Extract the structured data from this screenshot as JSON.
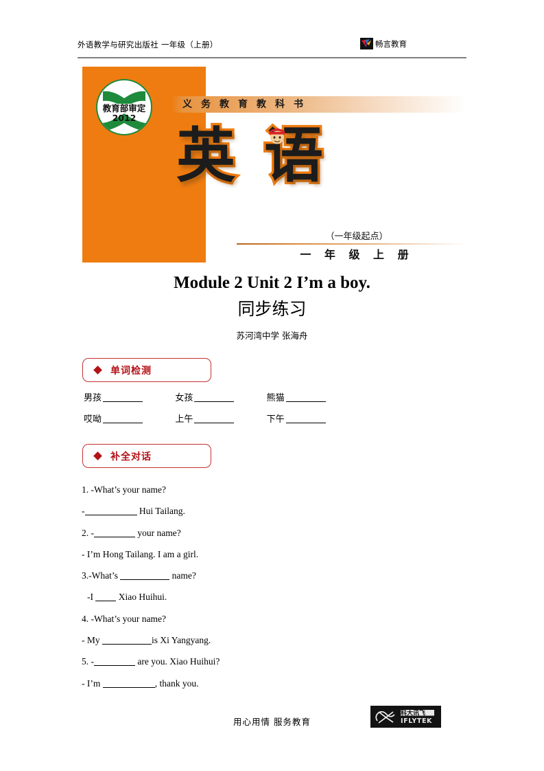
{
  "header": {
    "publisher_line": "外语教学与研究出版社  一年级（上册）",
    "brand_label": "畅言教育",
    "brand_logo_icon": "butterfly-logo-icon"
  },
  "cover": {
    "seal_text": "教育部审定",
    "seal_year": "2012",
    "band_text": "义务教育教科书",
    "subject_char_1": "英",
    "subject_char_2": "语",
    "mascot_icon": "cartoon-face-red-cap-icon",
    "starting_grade_note": "（一年级起点）",
    "grade_volume": "一 年 级 上 册",
    "orange": "#ef7c10",
    "seal_green": "#1e8b3c"
  },
  "document": {
    "title": "Module 2 Unit 2 I’m a boy.",
    "subtitle": "同步练习",
    "author": "苏河湾中学  张海舟"
  },
  "sections": [
    {
      "label": "单词检测",
      "bullet_icon": "red-diamond-icon",
      "accent_color": "#b31217",
      "border_color": "#c3312f"
    },
    {
      "label": "补全对话",
      "bullet_icon": "red-diamond-icon",
      "accent_color": "#b31217",
      "border_color": "#c3312f"
    }
  ],
  "vocabulary": {
    "rows": [
      [
        {
          "prompt": "男孩"
        },
        {
          "prompt": "女孩"
        },
        {
          "prompt": "熊猫"
        }
      ],
      [
        {
          "prompt": "哎呦"
        },
        {
          "prompt": "上午"
        },
        {
          "prompt": "下午"
        }
      ]
    ]
  },
  "dialogue": {
    "lines": [
      {
        "pre": "1. -What’s your name?",
        "blank": "",
        "post": "",
        "indent": false
      },
      {
        "pre": "-",
        "blank": "w10",
        "post": " Hui Tailang.",
        "indent": false
      },
      {
        "pre": "2. -",
        "blank": "w7",
        "post": " your name?",
        "indent": false
      },
      {
        "pre": "- I’m Hong Tailang. I am a girl.",
        "blank": "",
        "post": "",
        "indent": false
      },
      {
        "pre": "3.-What’s ",
        "blank": "w9",
        "post": " name?",
        "indent": false
      },
      {
        "pre": "-I ",
        "blank": "w4",
        "post": " Xiao Huihui.",
        "indent": true
      },
      {
        "pre": "4. -What’s your name?",
        "blank": "",
        "post": "",
        "indent": false
      },
      {
        "pre": "- My ",
        "blank": "w9",
        "post": "is Xi Yangyang.",
        "indent": false
      },
      {
        "pre": "5. -",
        "blank": "w7",
        "post": " are you. Xiao Huihui?",
        "indent": false
      },
      {
        "pre": "- I’m ",
        "blank": "w10",
        "post": ", thank you.",
        "indent": false
      }
    ]
  },
  "footer": {
    "slogan": "用心用情   服务教育",
    "logo_icon": "iflytek-logo-icon",
    "logo_text_cn": "科大讯飞",
    "logo_text_en": "IFLYTEK"
  }
}
